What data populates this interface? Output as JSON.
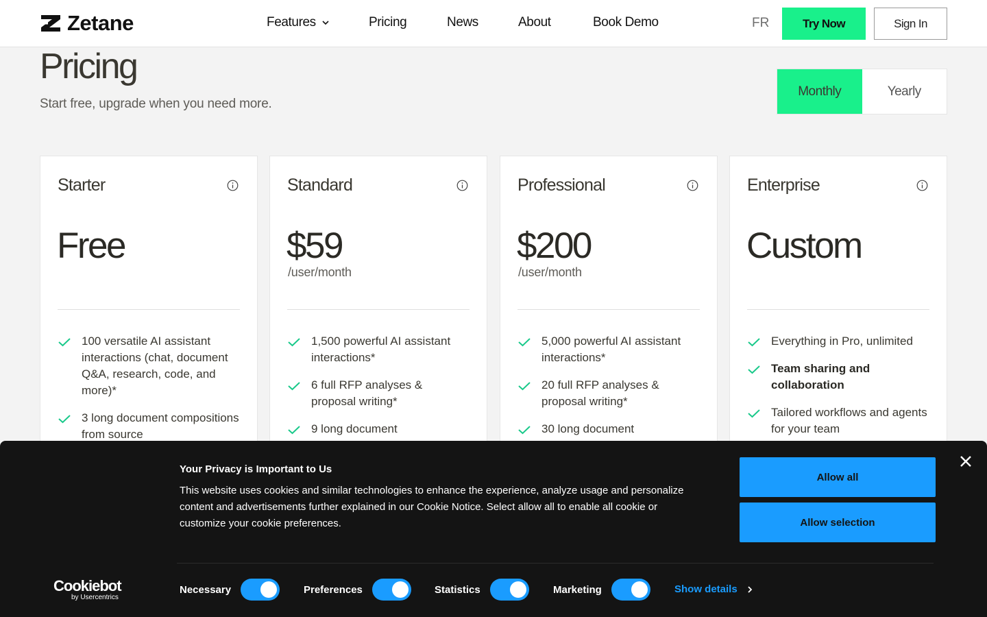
{
  "header": {
    "logo_text": "Zetane",
    "nav": [
      {
        "label": "Features",
        "has_dropdown": true
      },
      {
        "label": "Pricing"
      },
      {
        "label": "News"
      },
      {
        "label": "About"
      },
      {
        "label": "Book Demo"
      }
    ],
    "lang": "FR",
    "try_label": "Try Now",
    "signin_label": "Sign In"
  },
  "hero": {
    "title": "Pricing",
    "subtitle": "Start free, upgrade when you need more.",
    "billing_options": [
      "Monthly",
      "Yearly"
    ],
    "billing_selected": "Monthly"
  },
  "plans": [
    {
      "name": "Starter",
      "price": "Free",
      "per": "",
      "features": [
        {
          "text": "100 versatile AI assistant interactions (chat, document Q&A, research, code, and more)*",
          "bold": false
        },
        {
          "text": "3 long document compositions from source",
          "bold": false
        }
      ]
    },
    {
      "name": "Standard",
      "price": "$59",
      "per": "/user/month",
      "features": [
        {
          "text": "1,500 powerful AI assistant interactions*",
          "bold": false
        },
        {
          "text": "6 full RFP analyses & proposal writing*",
          "bold": false
        },
        {
          "text": "9 long document",
          "bold": false
        }
      ]
    },
    {
      "name": "Professional",
      "price": "$200",
      "per": "/user/month",
      "features": [
        {
          "text": "5,000 powerful AI assistant interactions*",
          "bold": false
        },
        {
          "text": "20 full RFP analyses & proposal writing*",
          "bold": false
        },
        {
          "text": "30 long document",
          "bold": false
        }
      ]
    },
    {
      "name": "Enterprise",
      "price": "Custom",
      "per": "",
      "features": [
        {
          "text": "Everything in Pro, unlimited",
          "bold": false
        },
        {
          "text": "Team sharing and collaboration",
          "bold": true
        },
        {
          "text": "Tailored workflows and agents for your team",
          "bold": false
        }
      ]
    }
  ],
  "cookie": {
    "title": "Your Privacy is Important to Us",
    "text": "This website uses cookies and similar technologies to enhance the experience, analyze usage and personalize content and advertisements further explained in our Cookie Notice. Select allow all to enable all cookie or customize your cookie preferences.",
    "allow_all": "Allow all",
    "allow_selection": "Allow selection",
    "brand": "Cookiebot",
    "brand_sub": "by Usercentrics",
    "categories": [
      {
        "label": "Necessary",
        "enabled": true
      },
      {
        "label": "Preferences",
        "enabled": true
      },
      {
        "label": "Statistics",
        "enabled": true
      },
      {
        "label": "Marketing",
        "enabled": true
      }
    ],
    "show_details": "Show details"
  },
  "colors": {
    "accent": "#19f08b",
    "cookie_blue": "#1a9cff",
    "check": "#19c98a"
  }
}
